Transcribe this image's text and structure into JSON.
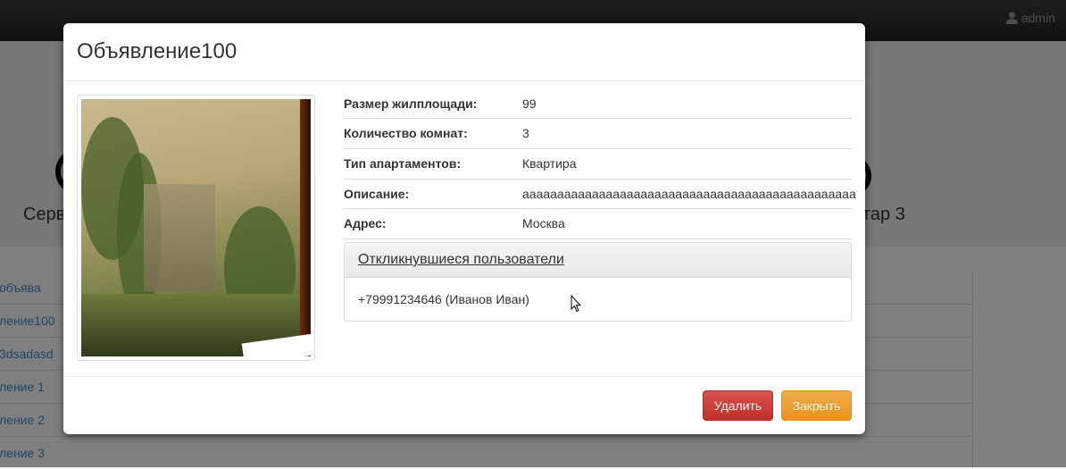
{
  "navbar": {
    "user_icon": "user-icon",
    "user_name": "admin"
  },
  "hero": {
    "left_text": "Серв",
    "right_text": "тар 3"
  },
  "background_list": [
    "объява",
    "ление100",
    "3dsadasd",
    "ление 1",
    "ление 2",
    "ление 3"
  ],
  "modal": {
    "title": "Объявление100",
    "details": [
      {
        "label": "Размер жилплощади:",
        "value": "99"
      },
      {
        "label": "Количество комнат:",
        "value": "3"
      },
      {
        "label": "Тип апартаментов:",
        "value": "Квартира"
      },
      {
        "label": "Описание:",
        "value": "аааааааааааааааааааааааааааааааааааааааааааааааа"
      },
      {
        "label": "Адрес:",
        "value": "Москва"
      }
    ],
    "responders": {
      "heading": "Откликнувшиеся пользователи",
      "items": [
        "+79991234646 (Иванов Иван)"
      ]
    },
    "buttons": {
      "delete": "Удалить",
      "close": "Закрыть"
    }
  },
  "colors": {
    "danger": "#d9534f",
    "warning": "#f0ad4e",
    "link": "#428bca"
  }
}
